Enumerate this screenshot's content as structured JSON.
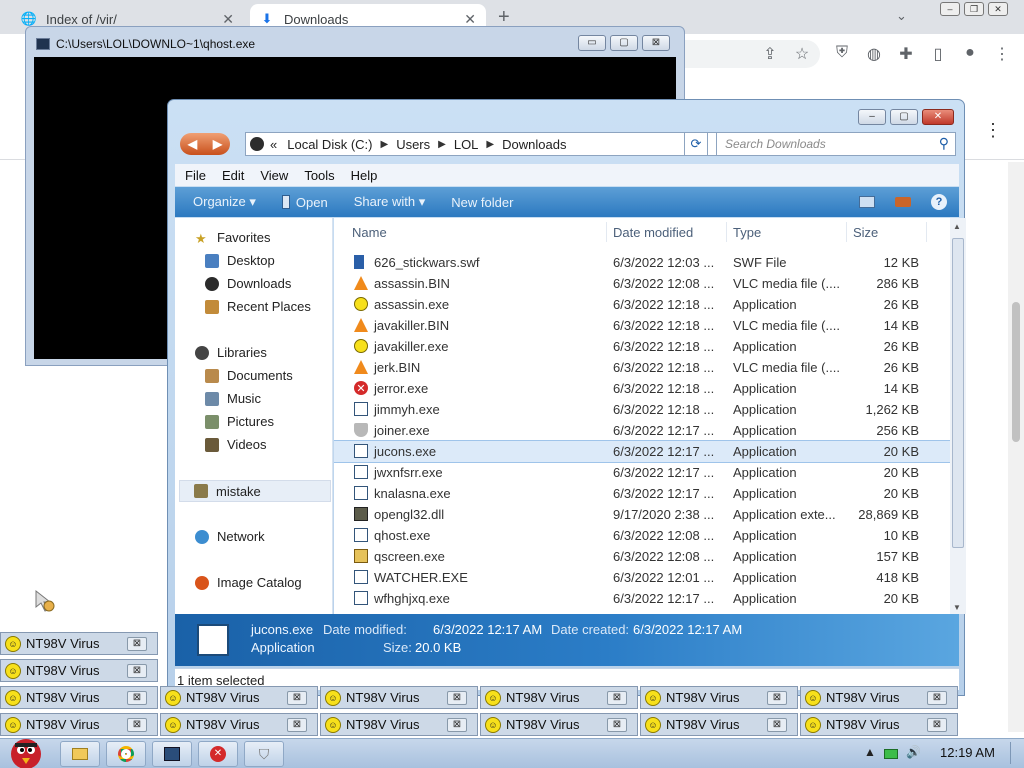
{
  "browser": {
    "tabs": [
      {
        "title": "Index of /vir/",
        "close": "✕"
      },
      {
        "title": "Downloads",
        "close": "✕"
      }
    ],
    "new_tab": "+",
    "tab_dropdown": "⌄",
    "toolbar_icons": [
      "share-icon",
      "star-icon",
      "ublock-icon",
      "extension-icon",
      "puzzle-icon",
      "sidepanel-icon",
      "profile-icon",
      "menu-icon"
    ]
  },
  "console_window": {
    "title": "C:\\Users\\LOL\\DOWNLO~1\\qhost.exe"
  },
  "explorer": {
    "address": {
      "prefix": "«",
      "crumbs": [
        "Local Disk (C:)",
        "Users",
        "LOL",
        "Downloads"
      ]
    },
    "search_placeholder": "Search Downloads",
    "menu": [
      "File",
      "Edit",
      "View",
      "Tools",
      "Help"
    ],
    "commands": {
      "organize": "Organize ▾",
      "open": "Open",
      "share": "Share with ▾",
      "new_folder": "New folder",
      "help": "?"
    },
    "nav": {
      "favorites": "Favorites",
      "desktop": "Desktop",
      "downloads": "Downloads",
      "recent": "Recent Places",
      "libraries": "Libraries",
      "documents": "Documents",
      "music": "Music",
      "pictures": "Pictures",
      "videos": "Videos",
      "mistake": "mistake",
      "network": "Network",
      "image_catalog": "Image Catalog"
    },
    "columns": {
      "name": "Name",
      "date": "Date modified",
      "type": "Type",
      "size": "Size"
    },
    "files": [
      {
        "name": "626_stickwars.swf",
        "date": "6/3/2022 12:03 ...",
        "type": "SWF File",
        "size": "12 KB",
        "icon": "swf-icon"
      },
      {
        "name": "assassin.BIN",
        "date": "6/3/2022 12:08 ...",
        "type": "VLC media file (....",
        "size": "286 KB",
        "icon": "vlc-icon"
      },
      {
        "name": "assassin.exe",
        "date": "6/3/2022 12:18 ...",
        "type": "Application",
        "size": "26 KB",
        "icon": "smiley-icon"
      },
      {
        "name": "javakiller.BIN",
        "date": "6/3/2022 12:18 ...",
        "type": "VLC media file (....",
        "size": "14 KB",
        "icon": "vlc-icon"
      },
      {
        "name": "javakiller.exe",
        "date": "6/3/2022 12:18 ...",
        "type": "Application",
        "size": "26 KB",
        "icon": "smiley-icon"
      },
      {
        "name": "jerk.BIN",
        "date": "6/3/2022 12:18 ...",
        "type": "VLC media file (....",
        "size": "26 KB",
        "icon": "vlc-icon"
      },
      {
        "name": "jerror.exe",
        "date": "6/3/2022 12:18 ...",
        "type": "Application",
        "size": "14 KB",
        "icon": "error-icon"
      },
      {
        "name": "jimmyh.exe",
        "date": "6/3/2022 12:18 ...",
        "type": "Application",
        "size": "1,262 KB",
        "icon": "app-icon"
      },
      {
        "name": "joiner.exe",
        "date": "6/3/2022 12:17 ...",
        "type": "Application",
        "size": "256 KB",
        "icon": "shield-icon"
      },
      {
        "name": "jucons.exe",
        "date": "6/3/2022 12:17 ...",
        "type": "Application",
        "size": "20 KB",
        "icon": "app-icon",
        "selected": true
      },
      {
        "name": "jwxnfsrr.exe",
        "date": "6/3/2022 12:17 ...",
        "type": "Application",
        "size": "20 KB",
        "icon": "app-icon"
      },
      {
        "name": "knalasna.exe",
        "date": "6/3/2022 12:17 ...",
        "type": "Application",
        "size": "20 KB",
        "icon": "app-icon"
      },
      {
        "name": "opengl32.dll",
        "date": "9/17/2020 2:38 ...",
        "type": "Application exte...",
        "size": "28,869 KB",
        "icon": "dll-icon"
      },
      {
        "name": "qhost.exe",
        "date": "6/3/2022 12:08 ...",
        "type": "Application",
        "size": "10 KB",
        "icon": "app-icon"
      },
      {
        "name": "qscreen.exe",
        "date": "6/3/2022 12:08 ...",
        "type": "Application",
        "size": "157 KB",
        "icon": "qscreen-icon"
      },
      {
        "name": "WATCHER.EXE",
        "date": "6/3/2022 12:01 ...",
        "type": "Application",
        "size": "418 KB",
        "icon": "app-icon"
      },
      {
        "name": "wfhghjxq.exe",
        "date": "6/3/2022 12:17 ...",
        "type": "Application",
        "size": "20 KB",
        "icon": "app-icon"
      }
    ],
    "details": {
      "name": "jucons.exe",
      "type": "Application",
      "modified_label": "Date modified:",
      "modified_value": "6/3/2022 12:17 AM",
      "created_label": "Date created:",
      "created_value": "6/3/2022 12:17 AM",
      "size_label": "Size:",
      "size_value": "20.0 KB"
    },
    "status": "1 item selected"
  },
  "virus_popups": {
    "label": "NT98V Virus",
    "close": "⊠"
  },
  "taskbar": {
    "clock": "12:19 AM",
    "buttons": [
      "folder-icon",
      "chrome-icon",
      "explorer-icon",
      "error-icon",
      "shield-icon"
    ]
  },
  "colors": {
    "accent": "#2c79c0",
    "selection": "#dceaf9",
    "virus_popup": "#cdd9e7"
  }
}
